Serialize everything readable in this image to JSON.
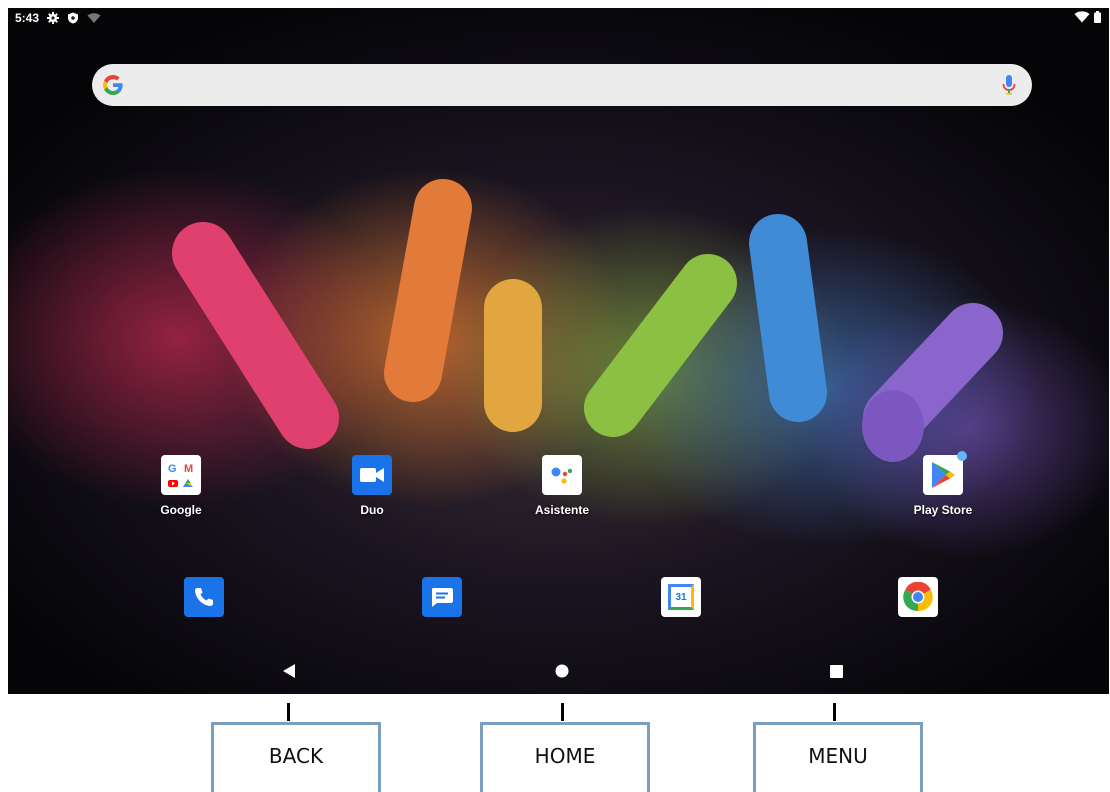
{
  "status_bar": {
    "time": "5:43"
  },
  "apps": [
    {
      "label": "Google"
    },
    {
      "label": "Duo"
    },
    {
      "label": "Asistente"
    },
    {
      "label": "Play Store"
    }
  ],
  "dock": {
    "items": [
      "phone-icon",
      "messages-icon",
      "calendar-icon",
      "chrome-icon"
    ],
    "calendar_day": "31"
  },
  "callouts": [
    {
      "label": "BACK"
    },
    {
      "label": "HOME"
    },
    {
      "label": "MENU"
    }
  ],
  "colors": {
    "google_blue": "#4285f4",
    "google_red": "#ea4335",
    "google_yellow": "#fbbc05",
    "google_green": "#34a853",
    "callout_border": "#7c9ec1"
  }
}
